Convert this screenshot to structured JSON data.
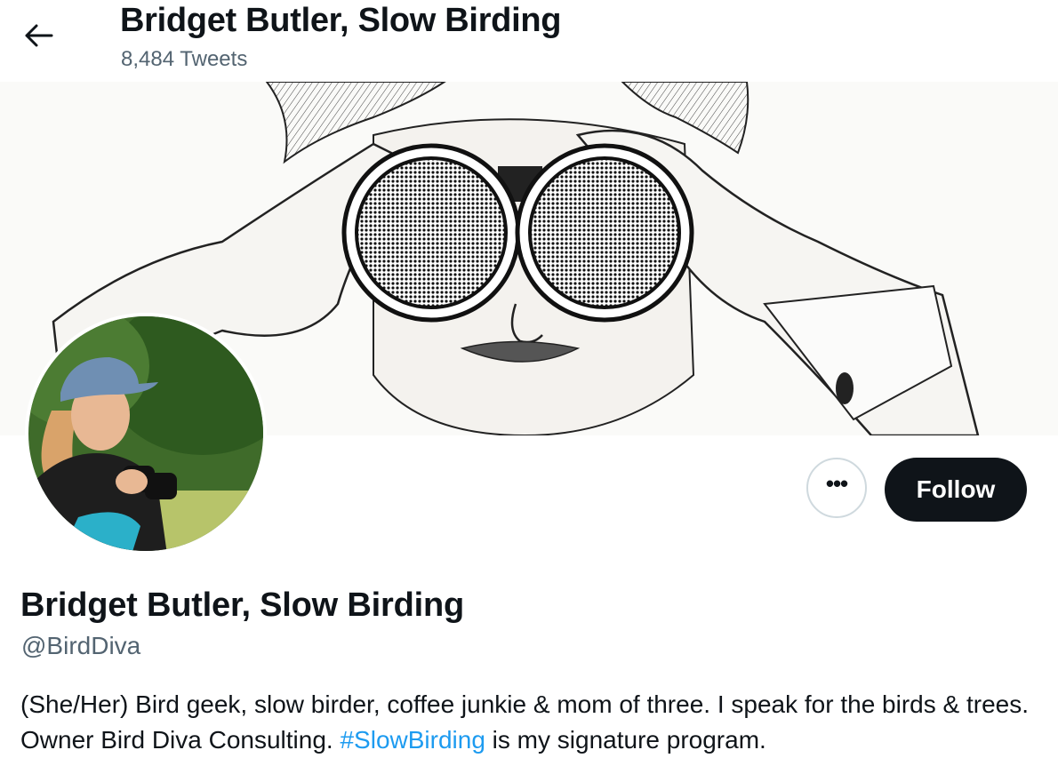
{
  "header": {
    "title": "Bridget Butler, Slow Birding",
    "tweet_count": "8,484 Tweets"
  },
  "icons": {
    "back": "arrow-left-icon",
    "more": "more-horizontal-icon"
  },
  "actions": {
    "more_label": "•••",
    "follow_label": "Follow"
  },
  "profile": {
    "name": "Bridget Butler, Slow Birding",
    "handle": "@BirdDiva",
    "bio_before": "(She/Her) Bird geek, slow birder, coffee junkie & mom of three. I speak for the birds & trees. Owner Bird Diva Consulting. ",
    "bio_hashtag": "#SlowBirding",
    "bio_after": " is my signature program."
  },
  "colors": {
    "text": "#0f1419",
    "secondary": "#536471",
    "link": "#1d9bf0",
    "follow_bg": "#0f1419"
  }
}
